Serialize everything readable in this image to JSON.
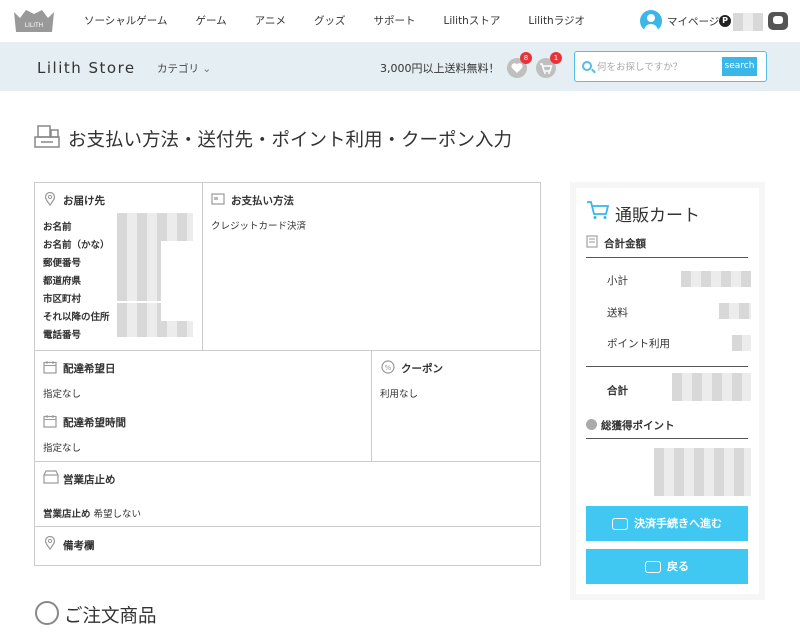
{
  "nav": {
    "logo_text": "LILITH",
    "links": [
      "ソーシャルゲーム",
      "ゲーム",
      "アニメ",
      "グッズ",
      "サポート",
      "Lilithストア",
      "Lilithラジオ"
    ],
    "mypage_label": "マイページ",
    "points_badge": "P"
  },
  "store_bar": {
    "title": "Lilith Store",
    "category_label": "カテゴリ",
    "shipping_notice": "3,000円以上送料無料！",
    "favorites_count": "8",
    "cart_count": "1",
    "search_placeholder": "何をお探しですか？",
    "search_button": "search"
  },
  "page": {
    "title": "お支払い方法・送付先・ポイント利用・クーポン入力",
    "order_items_title": "ご注文商品"
  },
  "delivery": {
    "heading": "お届け先",
    "labels": [
      "お名前",
      "お名前（かな）",
      "郵便番号",
      "都道府県",
      "市区町村",
      "それ以降の住所",
      "電話番号"
    ]
  },
  "payment": {
    "heading": "お支払い方法",
    "value": "クレジットカード決済"
  },
  "delivery_date": {
    "heading": "配達希望日",
    "value": "指定なし"
  },
  "delivery_time": {
    "heading": "配達希望時間",
    "value": "指定なし"
  },
  "coupon": {
    "heading": "クーポン",
    "value": "利用なし"
  },
  "store_pickup": {
    "heading": "営業店止め",
    "label": "営業店止め",
    "value": "希望しない"
  },
  "remarks": {
    "heading": "備考欄"
  },
  "cart": {
    "title": "通販カート",
    "total_heading": "合計金額",
    "subtotal_label": "小計",
    "shipping_label": "送料",
    "points_label": "ポイント利用",
    "total_label": "合計",
    "earned_points_heading": "総獲得ポイント",
    "proceed_button": "決済手続きへ進む",
    "back_button": "戻る"
  },
  "colors": {
    "accent": "#40c7f2",
    "store_bar_bg": "#e4eef3",
    "badge_red": "#e8333a"
  }
}
